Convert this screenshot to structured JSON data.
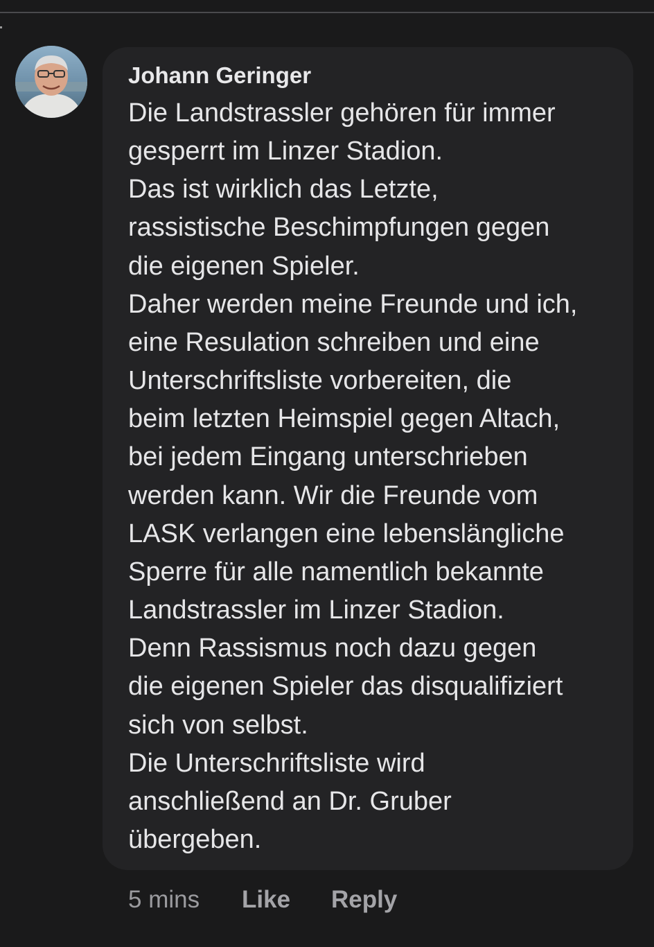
{
  "comment": {
    "author": "Johann Geringer",
    "avatar_icon": "user-photo-icon",
    "text_lines": [
      "Die Landstrassler gehören für immer",
      "gesperrt im Linzer Stadion.",
      "Das ist wirklich das Letzte,",
      "rassistische Beschimpfungen gegen",
      "die eigenen Spieler.",
      "Daher werden meine Freunde und ich,",
      "eine Resulation schreiben und eine",
      "Unterschriftsliste vorbereiten, die",
      "beim letzten Heimspiel gegen Altach,",
      "bei jedem Eingang unterschrieben",
      "werden kann. Wir die Freunde vom",
      "LASK verlangen eine lebenslängliche",
      "Sperre für alle namentlich bekannte",
      "Landstrassler im Linzer Stadion.",
      "Denn Rassismus noch dazu gegen",
      "die eigenen Spieler das disqualifiziert",
      "sich von selbst.",
      "Die Unterschriftsliste wird",
      "anschließend an Dr. Gruber",
      "übergeben."
    ],
    "timestamp": "5 mins",
    "like_label": "Like",
    "reply_label": "Reply"
  },
  "colors": {
    "background": "#1a1a1b",
    "bubble": "#232325",
    "text": "#e6e6e8",
    "meta": "#9b9b9f"
  }
}
